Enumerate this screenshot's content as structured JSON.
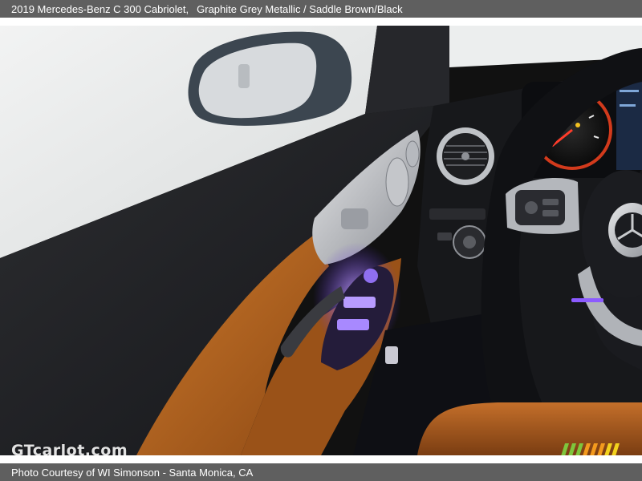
{
  "header": {
    "vehicle_title": "2019 Mercedes-Benz C 300 Cabriolet,",
    "vehicle_color": "Graphite Grey Metallic / Saddle Brown/Black"
  },
  "photo": {
    "subject": "driver door panel, side mirror, steering wheel and instrument cluster",
    "colors": {
      "leather": "#b8651f",
      "trim_dark": "#1e1f22",
      "ambient_light": "#8c5bff",
      "cluster_red": "#d23a1c"
    }
  },
  "watermark": {
    "text": "GTcarlot.com"
  },
  "footer": {
    "credit": "Photo Courtesy of WI Simonson - Santa Monica, CA"
  },
  "logo": {
    "stripe_colors": [
      "#7ec63c",
      "#7ec63c",
      "#7ec63c",
      "#f39a1d",
      "#f39a1d",
      "#f39a1d",
      "#f3d21d",
      "#f3d21d"
    ]
  }
}
